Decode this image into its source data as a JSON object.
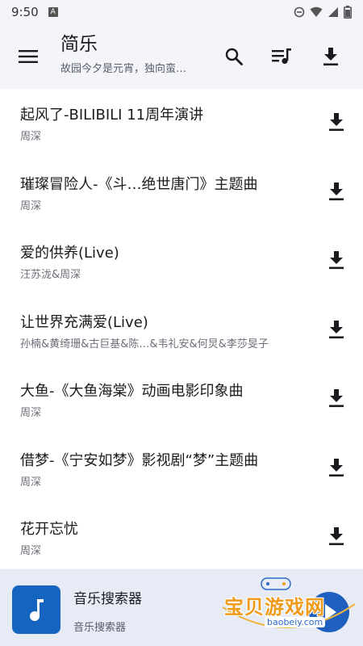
{
  "status_bar": {
    "time": "9:50",
    "notification_letter": "A"
  },
  "app_bar": {
    "title": "简乐",
    "subtitle": "故园今夕是元宵，独向蛮…"
  },
  "songs": [
    {
      "title": "起风了-BILIBILI 11周年演讲",
      "artist": "周深"
    },
    {
      "title": "璀璨冒险人-《斗…绝世唐门》主题曲",
      "artist": "周深"
    },
    {
      "title": "爱的供养(Live)",
      "artist": "汪苏泷&周深"
    },
    {
      "title": "让世界充满爱(Live)",
      "artist": "孙楠&黄绮珊&古巨基&陈…&韦礼安&何炅&李莎旻子"
    },
    {
      "title": "大鱼-《大鱼海棠》动画电影印象曲",
      "artist": "周深"
    },
    {
      "title": "借梦-《宁安如梦》影视剧“梦”主题曲",
      "artist": "周深"
    },
    {
      "title": "花开忘忧",
      "artist": "周深"
    }
  ],
  "player": {
    "title": "音乐搜索器",
    "subtitle": "音乐搜索器"
  },
  "watermark": {
    "text": "宝贝游戏网",
    "url": "baobeiy.com"
  },
  "colors": {
    "accent": "#1e5fc0",
    "player_bg": "#e6ebf5",
    "watermark": "#f09a1a"
  },
  "icons": [
    "menu-icon",
    "search-icon",
    "playlist-icon",
    "download-icon",
    "music-note-icon",
    "play-icon"
  ]
}
